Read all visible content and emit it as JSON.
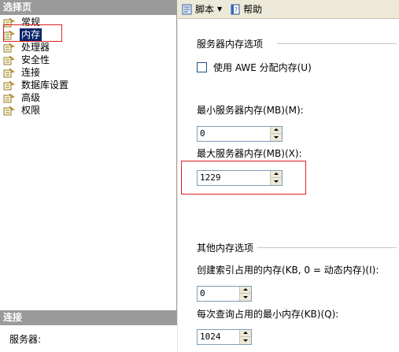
{
  "left_pane": {
    "header": "选择页",
    "pages": [
      {
        "label": "常规",
        "selected": false
      },
      {
        "label": "内存",
        "selected": true
      },
      {
        "label": "处理器",
        "selected": false
      },
      {
        "label": "安全性",
        "selected": false
      },
      {
        "label": "连接",
        "selected": false
      },
      {
        "label": "数据库设置",
        "selected": false
      },
      {
        "label": "高级",
        "selected": false
      },
      {
        "label": "权限",
        "selected": false
      }
    ],
    "connection_header": "连接",
    "server_label": "服务器:"
  },
  "toolbar": {
    "script_label": "脚本",
    "help_label": "帮助"
  },
  "server_memory": {
    "title": "服务器内存选项",
    "awe_label": "使用 AWE 分配内存(U)",
    "awe_checked": false,
    "min_label": "最小服务器内存(MB)(M):",
    "min_value": "0",
    "max_label": "最大服务器内存(MB)(X):",
    "max_value": "1229"
  },
  "other_memory": {
    "title": "其他内存选项",
    "index_label": "创建索引占用的内存(KB, 0 = 动态内存)(I):",
    "index_value": "0",
    "query_label": "每次查询占用的最小内存(KB)(Q):",
    "query_value": "1024"
  },
  "colors": {
    "highlight_border": "#e02020",
    "selection_bg": "#0a246a",
    "header_bg": "#9a9a9a"
  }
}
